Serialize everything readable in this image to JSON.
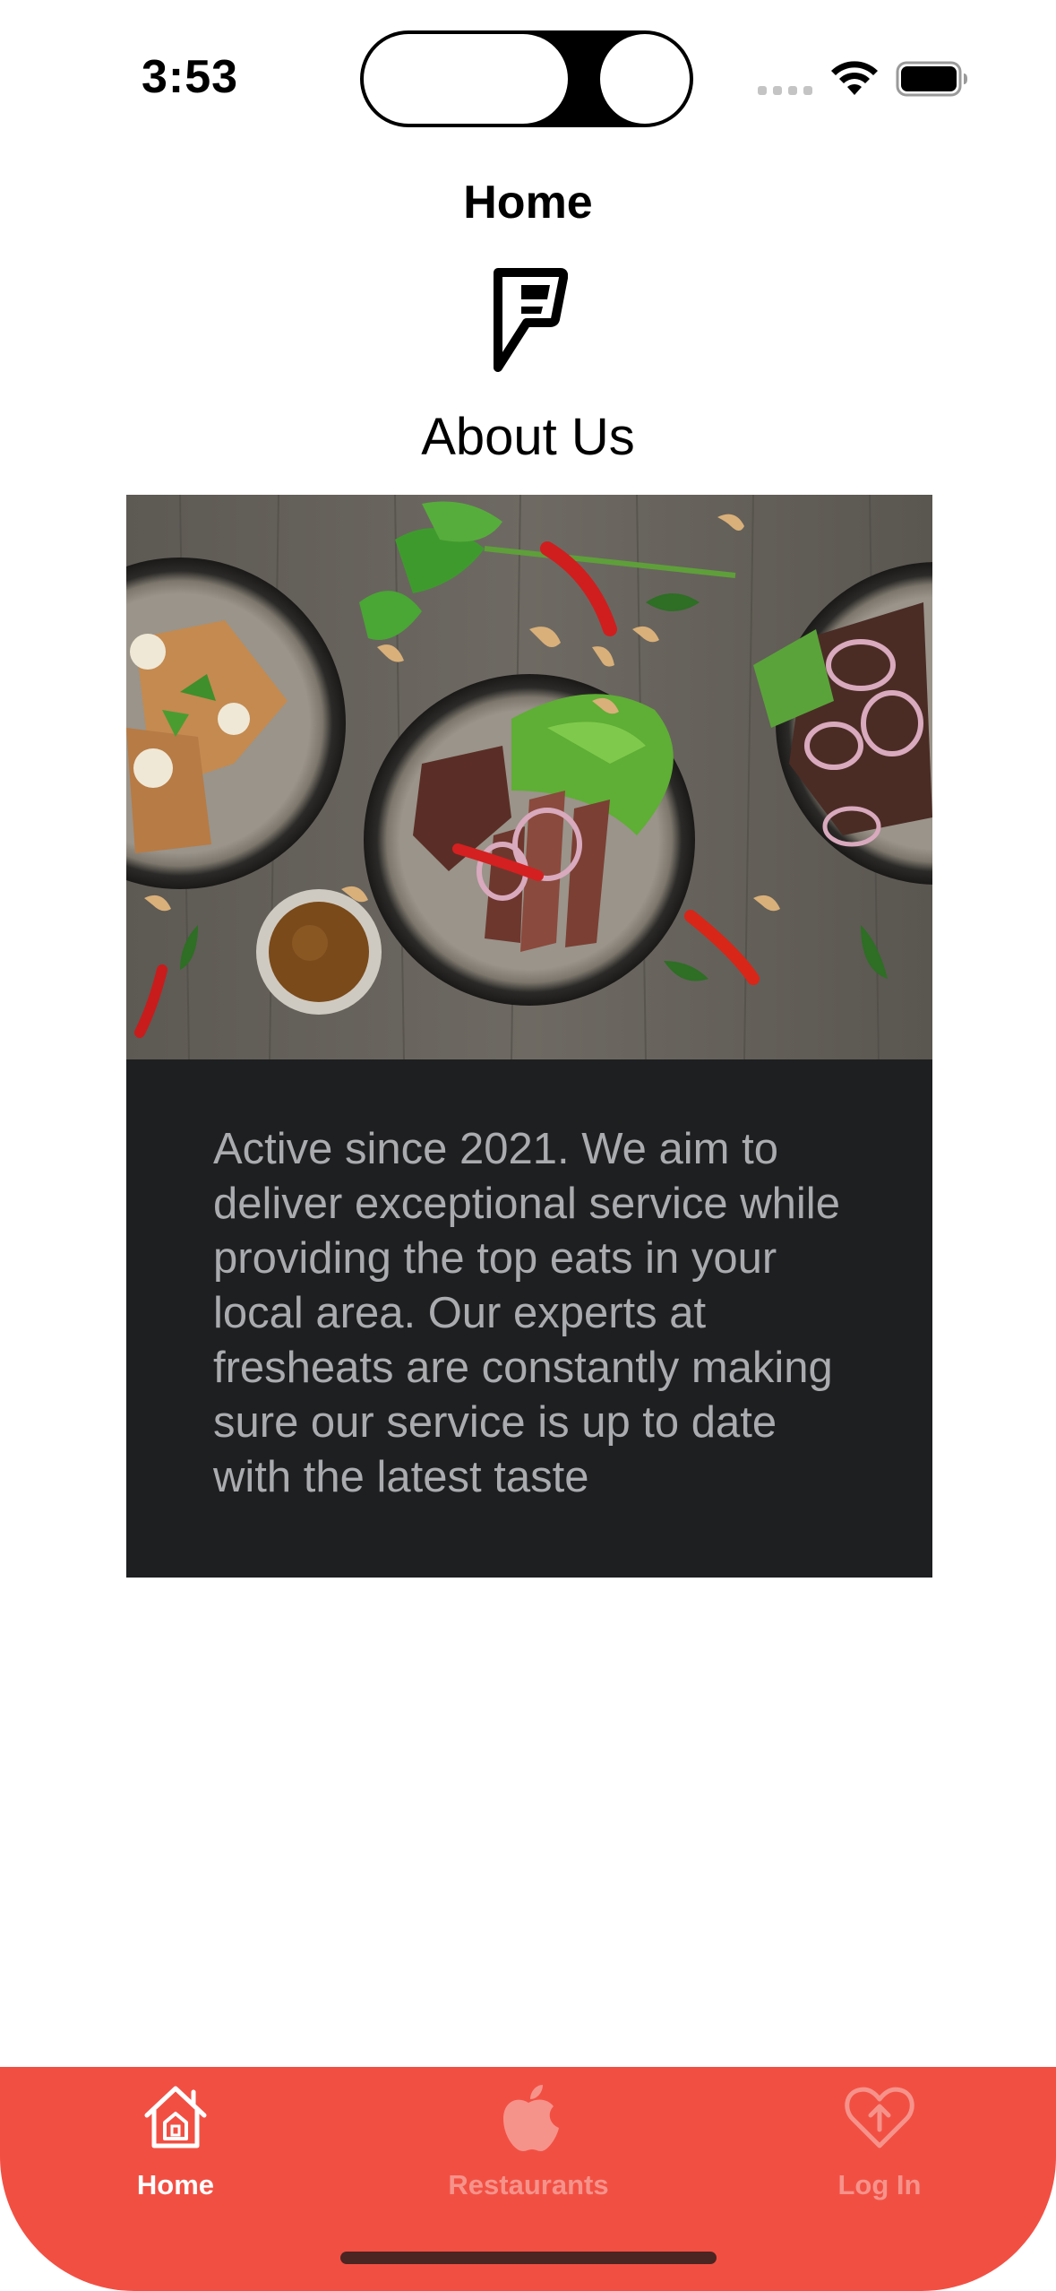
{
  "status_bar": {
    "time": "3:53"
  },
  "header": {
    "title": "Home",
    "logo_icon": "foursquare-f-icon"
  },
  "about": {
    "heading": "About Us",
    "image_alt": "food-platters-photo",
    "body": "Active since 2021. We aim to deliver exceptional service while providing the top eats in your local area. Our experts at fresheats are constantly making sure our service is up to date with the latest taste"
  },
  "tabbar": {
    "background_color": "#f24f43",
    "active_color": "#ffffff",
    "inactive_color": "#f5938b",
    "tabs": [
      {
        "label": "Home",
        "icon": "house-icon",
        "active": true
      },
      {
        "label": "Restaurants",
        "icon": "apple-icon",
        "active": false
      },
      {
        "label": "Log In",
        "icon": "heart-upload-icon",
        "active": false
      }
    ]
  },
  "colors": {
    "card_background": "#1e1f21",
    "card_text": "#a9abae"
  }
}
